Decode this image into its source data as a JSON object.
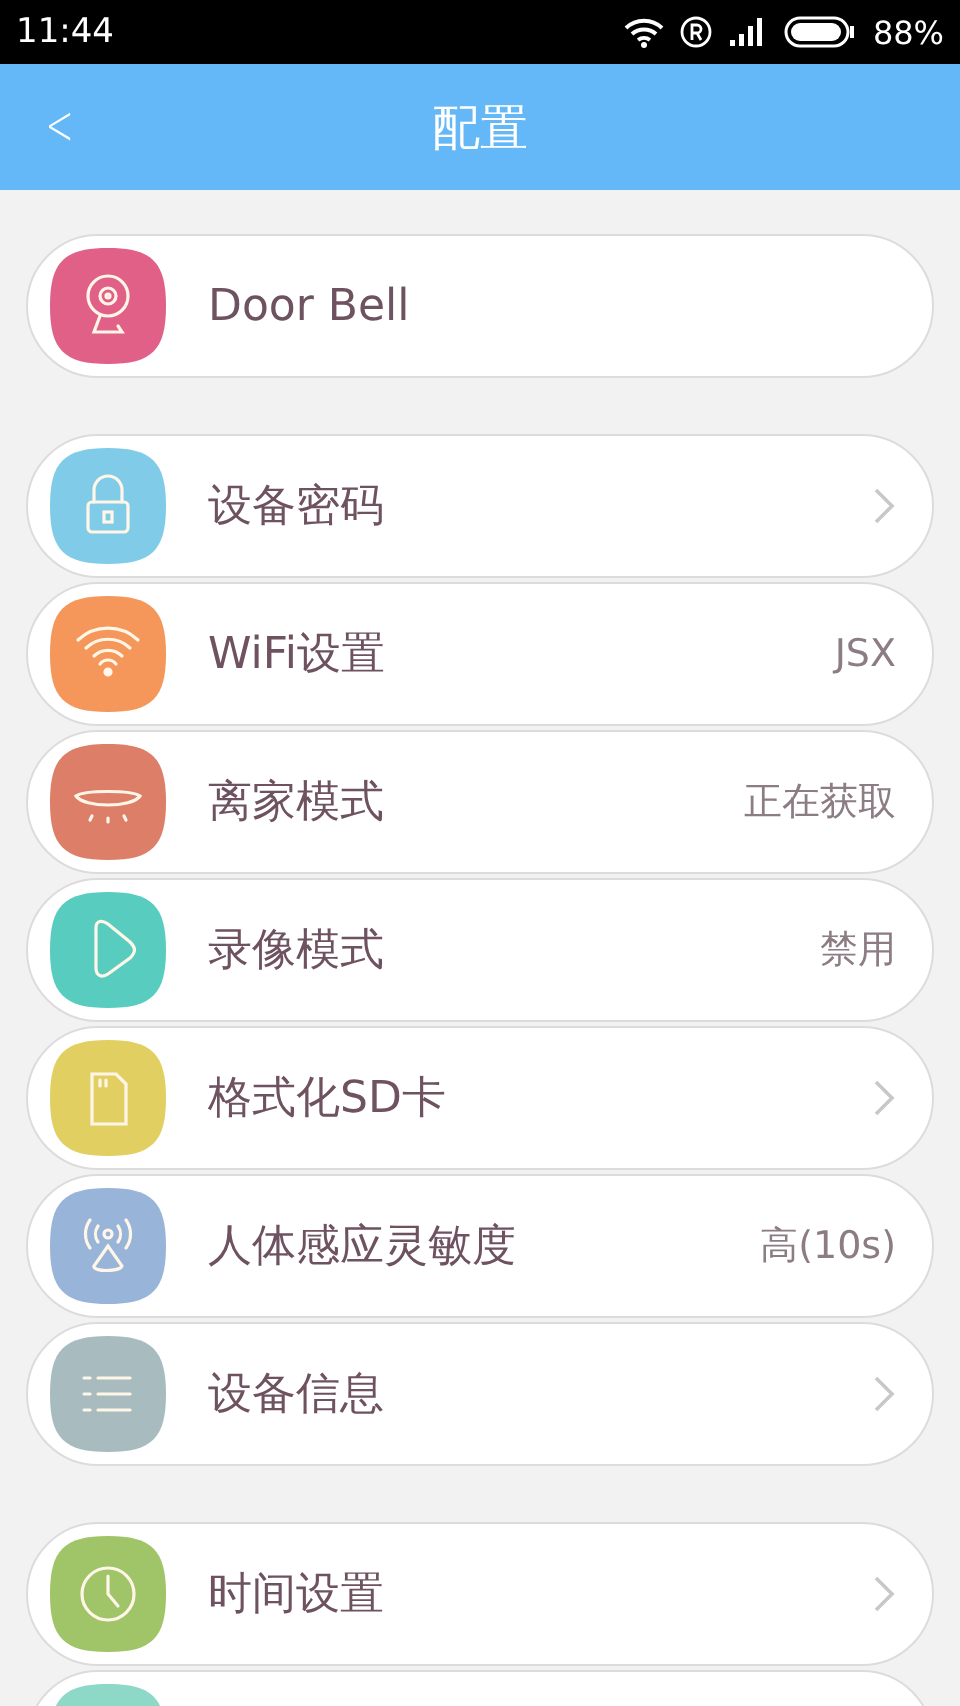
{
  "status_bar": {
    "time": "11:44",
    "battery": "88%"
  },
  "header": {
    "back": "<",
    "title": "配置"
  },
  "groups": [
    {
      "rows": [
        {
          "kind": "camera",
          "color": "#e06088",
          "label": "Door Bell",
          "chevron": false
        }
      ]
    },
    {
      "rows": [
        {
          "kind": "lock",
          "color": "#80cce8",
          "label": "设备密码",
          "chevron": true
        },
        {
          "kind": "wifi",
          "color": "#f5965a",
          "label": "WiFi设置",
          "value": "JSX",
          "chevron": false
        },
        {
          "kind": "lamp",
          "color": "#dc7e68",
          "label": "离家模式",
          "value": "正在获取",
          "chevron": false
        },
        {
          "kind": "play",
          "color": "#58cdbf",
          "label": "录像模式",
          "value": "禁用",
          "chevron": false
        },
        {
          "kind": "card",
          "color": "#e2cf62",
          "label": "格式化SD卡",
          "chevron": true
        },
        {
          "kind": "sensor",
          "color": "#98b4d8",
          "label": "人体感应灵敏度",
          "value": "高(10s)",
          "chevron": false
        },
        {
          "kind": "list",
          "color": "#a8bcc0",
          "label": "设备信息",
          "chevron": true
        }
      ]
    },
    {
      "rows": [
        {
          "kind": "clock",
          "color": "#a0c468",
          "label": "时间设置",
          "chevron": true
        },
        {
          "kind": "blank",
          "color": "#8ed8c8"
        }
      ]
    }
  ]
}
